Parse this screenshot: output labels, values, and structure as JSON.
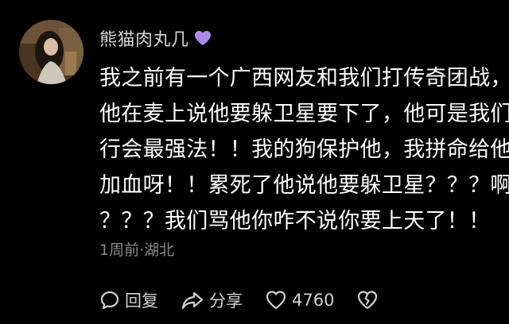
{
  "comment": {
    "user": {
      "name": "熊猫肉丸几",
      "badge_icon": "purple-heart-icon",
      "badge_color": "#a98ae8"
    },
    "content_lines": [
      "我之前有一个广西网友和我们打传奇团战，",
      "他在麦上说他要躲卫星要下了，他可是我们",
      "行会最强法！！我的狗保护他，我拼命给他",
      "加血呀！！累死了他说他要躲卫星？？？啊",
      "？？？我们骂他你咋不说你要上天了！！"
    ],
    "meta": "1周前·湖北",
    "actions": {
      "reply_label": "回复",
      "share_label": "分享",
      "like_count": "4760"
    }
  }
}
